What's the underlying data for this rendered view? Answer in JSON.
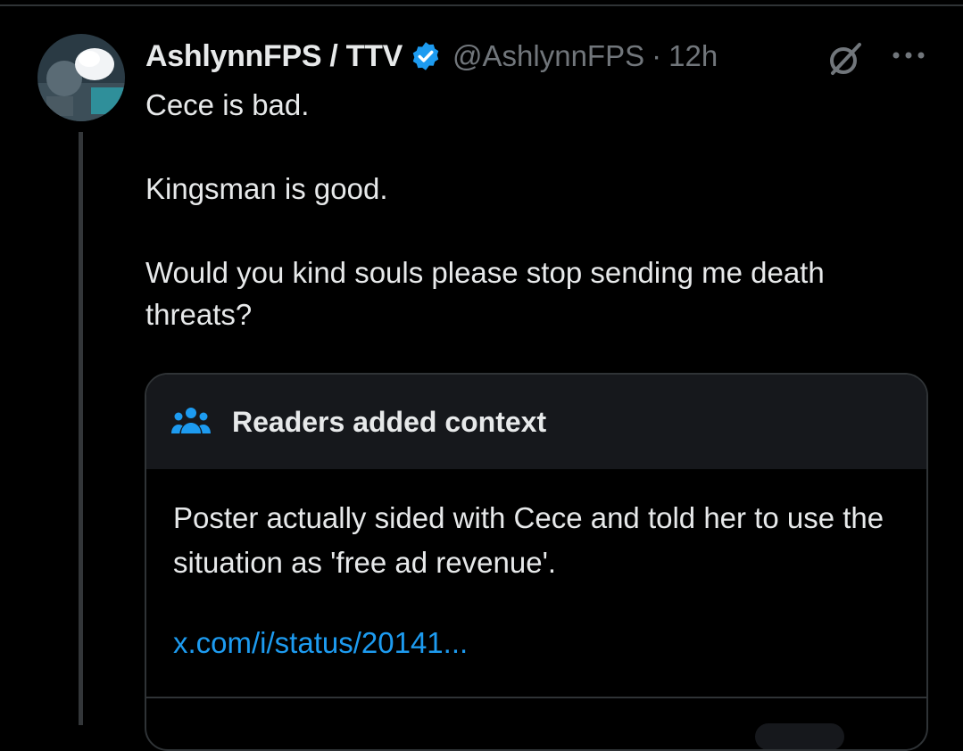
{
  "post": {
    "display_name": "AshlynnFPS / TTV",
    "handle": "@AshlynnFPS",
    "separator": "·",
    "timestamp": "12h",
    "text_lines": [
      "Cece is bad.",
      "Kingsman is good.",
      "Would you kind souls please stop sending me death threats?"
    ]
  },
  "community_note": {
    "title": "Readers added context",
    "body": "Poster actually sided with Cece and told her to use the situation as 'free ad revenue'.",
    "link": "x.com/i/status/20141..."
  },
  "icons": {
    "verified": "verified-badge-icon",
    "grok": "grok-icon",
    "more": "more-options-icon",
    "notes": "people-icon"
  },
  "colors": {
    "background": "#000000",
    "text_primary": "#e7e9ea",
    "text_secondary": "#71767b",
    "accent": "#1d9bf0",
    "border": "#2f3336",
    "note_header_bg": "#16181c"
  }
}
